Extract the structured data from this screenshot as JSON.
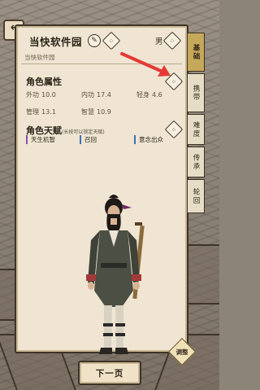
{
  "header": {
    "name": "当快软件园",
    "subname": "当快软件园",
    "gender": "男"
  },
  "attributes": {
    "title": "角色属性",
    "stats": [
      {
        "label": "外功",
        "value": "10.0"
      },
      {
        "label": "内功",
        "value": "17.4"
      },
      {
        "label": "轻身",
        "value": "4.6"
      },
      {
        "label": "管理",
        "value": "13.1"
      },
      {
        "label": "智慧",
        "value": "10.9"
      }
    ]
  },
  "talents": {
    "title": "角色天赋",
    "tip": "(长按可以锁定天赋)",
    "items": [
      "天生机智",
      "召回",
      "意念出众"
    ]
  },
  "buttons": {
    "adjust": "调整",
    "next": "下一页"
  },
  "tabs": [
    "基础",
    "携带",
    "难度",
    "传承",
    "轮回"
  ],
  "colors": {
    "panel": "#efe5d2",
    "active_tab": "#c6a85a",
    "arrow": "#e53935"
  }
}
